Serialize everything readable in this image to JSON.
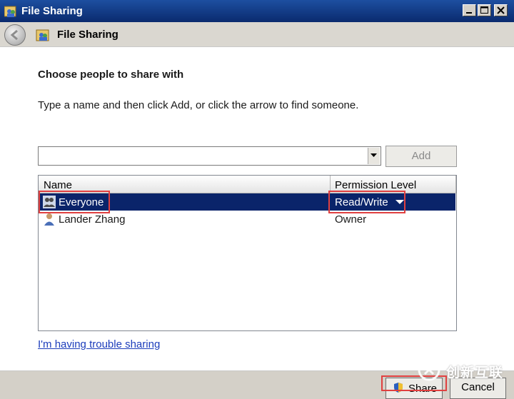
{
  "window": {
    "title": "File Sharing",
    "buttons": {
      "minimize": "_",
      "maximize": "□",
      "close": "✕"
    }
  },
  "nav": {
    "title": "File Sharing"
  },
  "content": {
    "heading": "Choose people to share with",
    "instruction": "Type a name and then click Add, or click the arrow to find someone.",
    "name_input": {
      "value": "",
      "placeholder": ""
    },
    "add_label": "Add",
    "columns": {
      "name": "Name",
      "permission": "Permission Level"
    },
    "people": [
      {
        "name": "Everyone",
        "permission": "Read/Write",
        "selected": true,
        "icon": "group-icon"
      },
      {
        "name": "Lander Zhang",
        "permission": "Owner",
        "selected": false,
        "icon": "user-icon"
      }
    ],
    "trouble_link": "I'm having trouble sharing"
  },
  "footer": {
    "share_label": "Share",
    "cancel_label": "Cancel"
  },
  "watermark": {
    "text": "创新互联"
  },
  "colors": {
    "titlebar": "#0a2a6e",
    "selection": "#0a246a",
    "highlight_box": "#e04040",
    "link": "#1c3dbb"
  }
}
